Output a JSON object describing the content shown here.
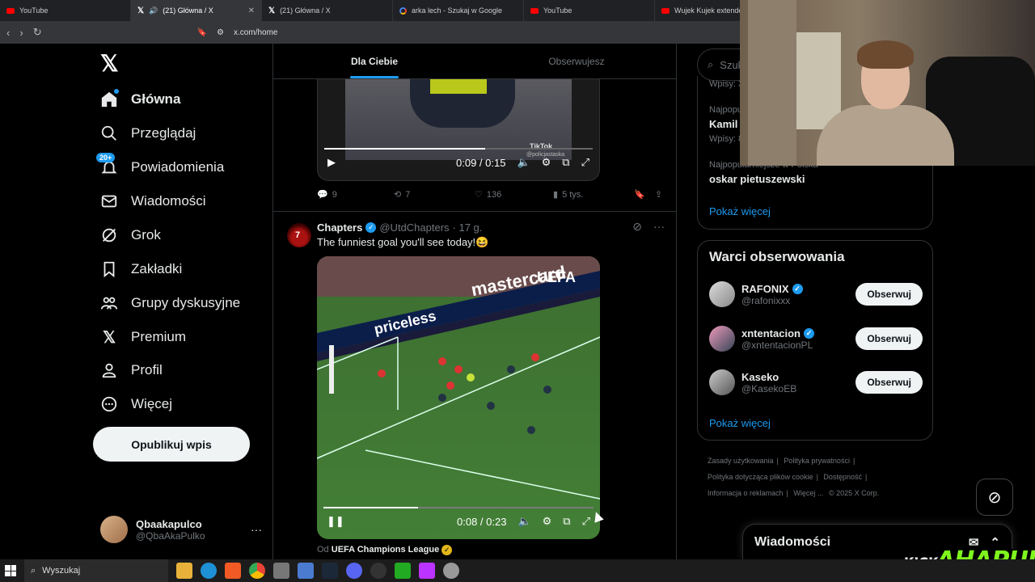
{
  "browser": {
    "tabs": [
      {
        "title": "YouTube",
        "favicon": "youtube-icon",
        "active": false
      },
      {
        "title": "(21) Główna / X",
        "favicon": "x-icon",
        "active": true
      },
      {
        "title": "(21) Główna / X",
        "favicon": "x-icon",
        "active": false
      },
      {
        "title": "arka lech - Szukaj w Google",
        "favicon": "google-icon",
        "active": false
      },
      {
        "title": "YouTube",
        "favicon": "youtube-icon",
        "active": false
      },
      {
        "title": "Wujek Kujek extended",
        "favicon": "youtube-icon",
        "active": false
      }
    ],
    "url": "x.com/home"
  },
  "sidebar": {
    "items": [
      {
        "label": "Główna",
        "icon": "home-icon"
      },
      {
        "label": "Przeglądaj",
        "icon": "search-icon"
      },
      {
        "label": "Powiadomienia",
        "icon": "bell-icon",
        "badge": "20+"
      },
      {
        "label": "Wiadomości",
        "icon": "mail-icon"
      },
      {
        "label": "Grok",
        "icon": "grok-icon"
      },
      {
        "label": "Zakładki",
        "icon": "bookmark-icon"
      },
      {
        "label": "Grupy dyskusyjne",
        "icon": "people-icon"
      },
      {
        "label": "Premium",
        "icon": "x-icon"
      },
      {
        "label": "Profil",
        "icon": "person-icon"
      },
      {
        "label": "Więcej",
        "icon": "more-circle-icon"
      }
    ],
    "post_button": "Opublikuj wpis",
    "user": {
      "name": "Qbaakapulco",
      "handle": "@QbaAkaPulko"
    }
  },
  "feed": {
    "tabs": [
      "Dla Ciebie",
      "Obserwujesz"
    ],
    "tweet1": {
      "video": {
        "time": "0:09 / 0:15",
        "progress": 0.6,
        "watermark": "TikTok",
        "watermark_handle": "@policjastaska"
      },
      "stats": {
        "replies": "9",
        "reposts": "7",
        "likes": "136",
        "views": "5 tys."
      }
    },
    "tweet2": {
      "name": "Chapters",
      "handle": "@UtdChapters",
      "time": "· 17 g.",
      "text": "The funniest goal you'll see today!😆",
      "video": {
        "time": "0:08 / 0:23",
        "progress": 0.35,
        "ad_text1": "mastercard",
        "ad_text2": "UEFA",
        "ad_text3": "priceless"
      },
      "from_label": "Od",
      "from_name": "UEFA Champions League"
    }
  },
  "right": {
    "search_placeholder": "Szukaj",
    "trends": [
      {
        "meta": "Wpisy: 3",
        "name": ""
      },
      {
        "meta": "Najpopu",
        "name": "Kamil"
      },
      {
        "meta": "Wpisy: 8",
        "name": ""
      },
      {
        "meta": "Najpopularniejsze w Polska",
        "name": "oskar pietuszewski"
      }
    ],
    "show_more": "Pokaż więcej",
    "who_title": "Warci obserwowania",
    "who": [
      {
        "name": "RAFONIX",
        "handle": "@rafonixxx",
        "verified": true
      },
      {
        "name": "xntentacion",
        "handle": "@xntentacionPL",
        "verified": true
      },
      {
        "name": "Kaseko",
        "handle": "@KasekoEB",
        "verified": false
      }
    ],
    "follow_label": "Obserwuj",
    "show_more2": "Pokaż więcej",
    "footer": [
      "Zasady użytkowania",
      "|",
      "Polityka prywatności",
      "|",
      "Polityka dotycząca plików cookie",
      "|",
      "Dostępność",
      "|",
      "Informacja o reklamach",
      "|",
      "Więcej ...",
      "© 2025 X Corp."
    ],
    "messages_title": "Wiadomości"
  },
  "overlay": {
    "kick": "KICK",
    "brand": "AHAPULCO"
  },
  "taskbar": {
    "search_placeholder": "Wyszukaj"
  }
}
